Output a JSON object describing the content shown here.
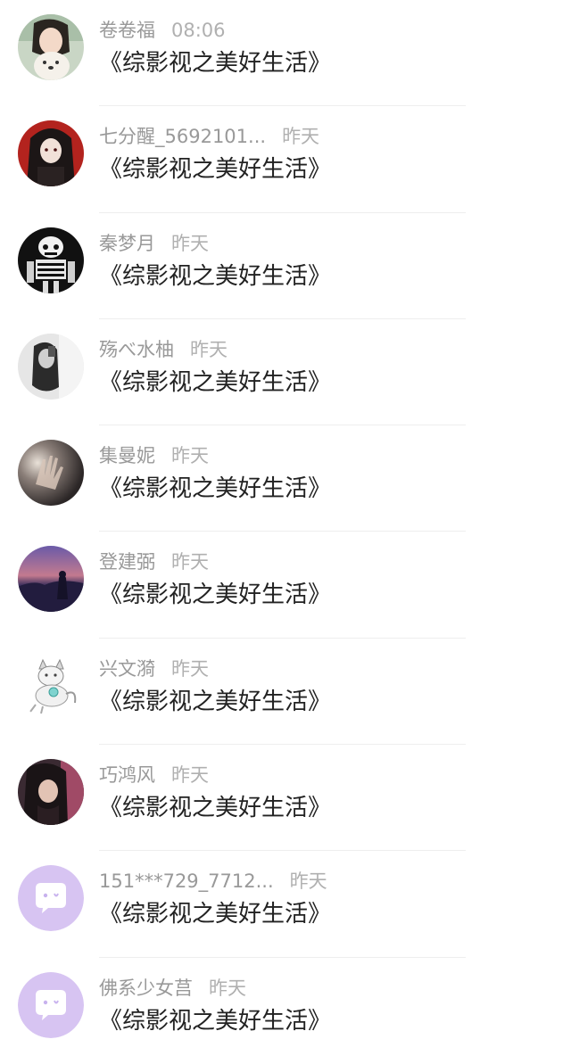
{
  "colors": {
    "placeholder_avatar_bg": "#d7c4f2",
    "placeholder_avatar_icon": "#ffffff",
    "name_text": "#999999",
    "time_text": "#b0b0b0",
    "message_text": "#222222",
    "divider": "#eeeeee"
  },
  "rows": [
    {
      "name": "卷卷福",
      "time": "08:06",
      "message": "《综影视之美好生活》",
      "avatar": "photo-girl-with-dog"
    },
    {
      "name": "七分醒_5692101...",
      "time": "昨天",
      "message": "《综影视之美好生活》",
      "avatar": "anime-girl-red-background"
    },
    {
      "name": "秦梦月",
      "time": "昨天",
      "message": "《综影视之美好生活》",
      "avatar": "skeleton-graphic"
    },
    {
      "name": "殇べ水柚",
      "time": "昨天",
      "message": "《综影视之美好生活》",
      "avatar": "grayscale-girl-photo"
    },
    {
      "name": "集曼妮",
      "time": "昨天",
      "message": "《综影视之美好生活》",
      "avatar": "hand-light-photo"
    },
    {
      "name": "登建弼",
      "time": "昨天",
      "message": "《综影视之美好生活》",
      "avatar": "sunset-silhouette"
    },
    {
      "name": "兴文漪",
      "time": "昨天",
      "message": "《综影视之美好生活》",
      "avatar": "white-cat-illustration"
    },
    {
      "name": "巧鸿风",
      "time": "昨天",
      "message": "《综影视之美好生活》",
      "avatar": "girl-dark-hair-photo"
    },
    {
      "name": "151***729_7712...",
      "time": "昨天",
      "message": "《综影视之美好生活》",
      "avatar": "default-chat-bubble-icon"
    },
    {
      "name": "佛系少女莒",
      "time": "昨天",
      "message": "《综影视之美好生活》",
      "avatar": "default-chat-bubble-icon"
    }
  ]
}
